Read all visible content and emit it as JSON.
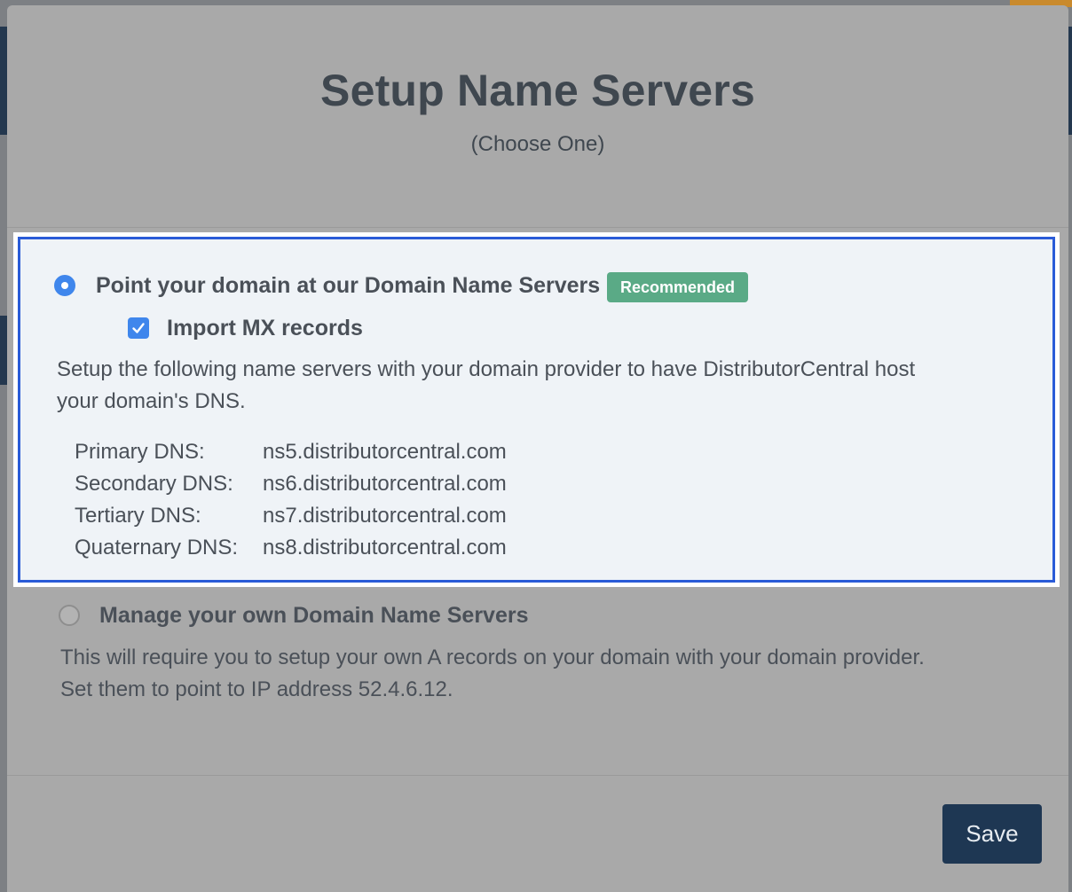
{
  "modal": {
    "title": "Setup Name Servers",
    "subtitle": "(Choose One)"
  },
  "options": {
    "nameservers": {
      "selected": true,
      "label": "Point your domain at our Domain Name Servers",
      "badge": "Recommended",
      "import_mx": {
        "checked": true,
        "label": "Import MX records"
      },
      "description_line1": "Setup the following name servers with your domain provider to have DistributorCentral host",
      "description_line2": "your domain's DNS.",
      "dns": [
        {
          "label": "Primary DNS:",
          "value": "ns5.distributorcentral.com"
        },
        {
          "label": "Secondary DNS:",
          "value": "ns6.distributorcentral.com"
        },
        {
          "label": "Tertiary DNS:",
          "value": "ns7.distributorcentral.com"
        },
        {
          "label": "Quaternary DNS:",
          "value": "ns8.distributorcentral.com"
        }
      ]
    },
    "own": {
      "selected": false,
      "label": "Manage your own Domain Name Servers",
      "description_line1": "This will require you to setup your own A records on your domain with your domain provider.",
      "description_line2": "Set them to point to IP address 52.4.6.12."
    }
  },
  "footer": {
    "save_label": "Save"
  },
  "colors": {
    "accent": "#3f86ec",
    "highlight_border": "#2a5bd7",
    "badge": "#5aaa86",
    "save_button": "#1e3753"
  }
}
